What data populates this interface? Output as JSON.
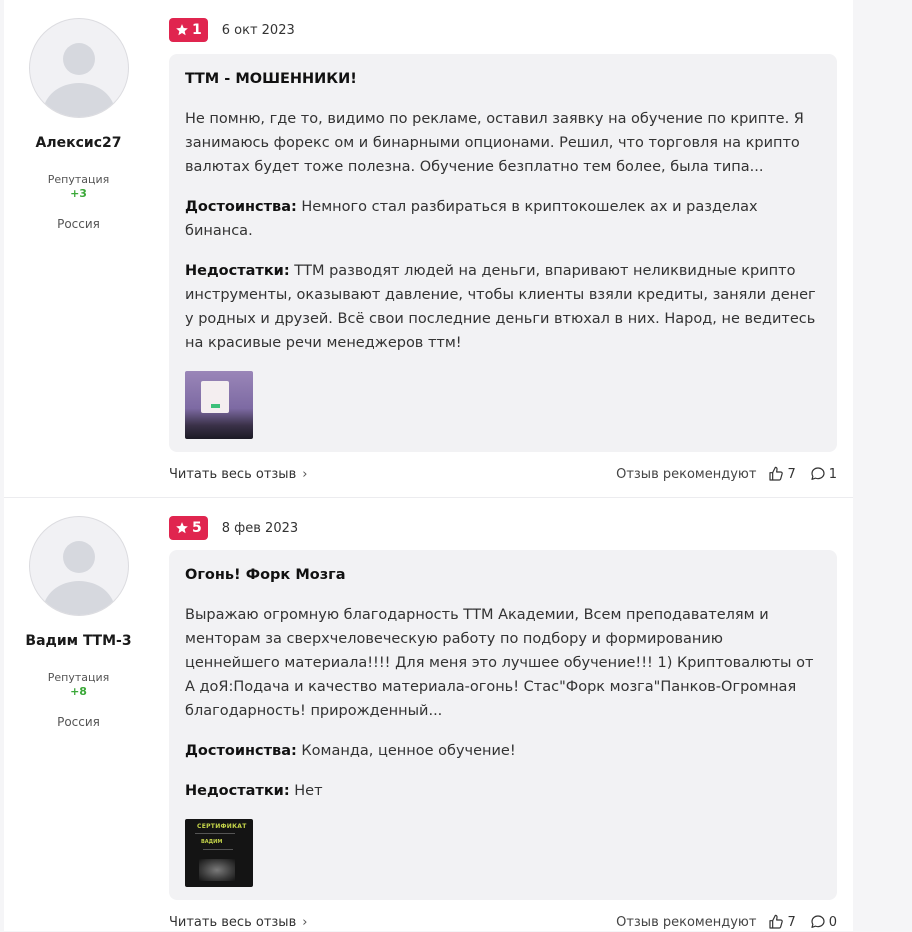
{
  "reviews": [
    {
      "author": {
        "name": "Алексис27",
        "reputation_label": "Репутация",
        "reputation_value": "+3",
        "country": "Россия"
      },
      "rating": "1",
      "date": "6 окт 2023",
      "title": "ТТМ - МОШЕННИКИ!",
      "text": "Не помню, где то, видимо по рекламе, оставил заявку на обучение по крипте. Я занимаюсь форекс ом и бинарными опционами. Решил, что торговля на крипто валютах будет тоже полезна. Обучение безплатно тем более, была типа...",
      "pros_label": "Достоинства:",
      "pros": " Немного стал разбираться в криптокошелек ах и разделах бинанса.",
      "cons_label": "Недостатки:",
      "cons": " ТТМ разводят людей на деньги, впаривают неликвидные крипто инструменты, оказывают давление, чтобы клиенты взяли кредиты, заняли денег у родных и друзей. Всё свои последние деньги втюхал в них. Народ, не ведитесь на красивые речи менеджеров ттм!",
      "read_more": "Читать весь отзыв",
      "recommend_label": "Отзыв рекомендуют",
      "likes": "7",
      "comments": "1"
    },
    {
      "author": {
        "name": "Вадим ТТМ-3",
        "reputation_label": "Репутация",
        "reputation_value": "+8",
        "country": "Россия"
      },
      "rating": "5",
      "date": "8 фев 2023",
      "title": "Огонь! Форк Мозга",
      "text": "Выражаю огромную благодарность ТТМ Академии, Всем преподавателям и менторам за сверхчеловеческую работу по подбору и формированию ценнейшего материала!!!! Для меня это лучшее обучение!!! 1) Криптовалюты от А доЯ:Подача и качество материала-огонь! Стас\"Форк мозга\"Панков-Огромная благодарность! прирожденный...",
      "pros_label": "Достоинства:",
      "pros": " Команда, ценное обучение!",
      "cons_label": "Недостатки:",
      "cons": " Нет",
      "certificate_title": "СЕРТИФИКАТ",
      "certificate_name": "ВАДИМ",
      "read_more": "Читать весь отзыв",
      "recommend_label": "Отзыв рекомендуют",
      "likes": "7",
      "comments": "0"
    }
  ],
  "colors": {
    "rating_badge": "#e0254f",
    "reputation": "#3ba839",
    "card_bg": "#f2f2f4"
  },
  "icons": {
    "rating": "star-icon",
    "read_more": "chevron-right-icon",
    "likes": "thumbs-up-icon",
    "comments": "comment-icon",
    "avatar": "user-placeholder-icon"
  }
}
